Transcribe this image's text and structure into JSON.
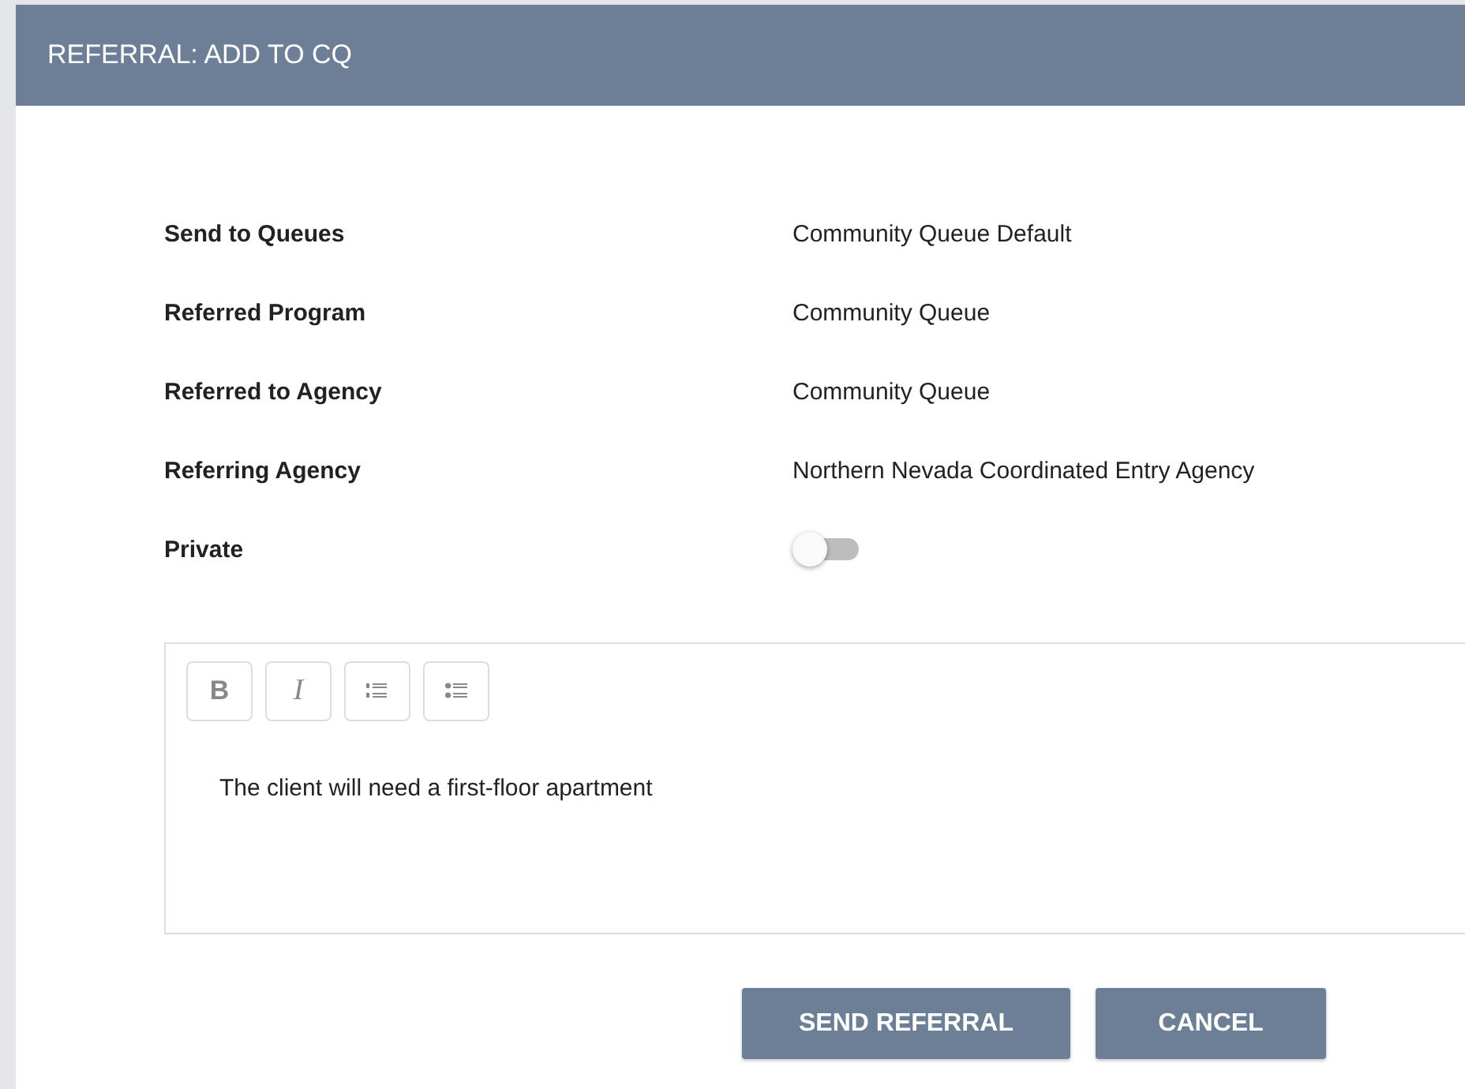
{
  "dialog": {
    "title": "REFERRAL: ADD TO CQ"
  },
  "fields": [
    {
      "kind": "text",
      "label": "Send to Queues",
      "value": "Community Queue Default"
    },
    {
      "kind": "text",
      "label": "Referred Program",
      "value": "Community Queue"
    },
    {
      "kind": "text",
      "label": "Referred to Agency",
      "value": "Community Queue"
    },
    {
      "kind": "text",
      "label": "Referring Agency",
      "value": "Northern Nevada Coordinated Entry Agency"
    },
    {
      "kind": "toggle",
      "label": "Private",
      "on": false
    }
  ],
  "editor": {
    "toolbar": [
      {
        "kind": "bold",
        "label": "B"
      },
      {
        "kind": "italic",
        "label": "I"
      },
      {
        "kind": "numbered-list"
      },
      {
        "kind": "bulleted-list"
      }
    ],
    "text": "The client will need a first-floor apartment"
  },
  "buttons": [
    "SEND REFERRAL",
    "CANCEL"
  ]
}
